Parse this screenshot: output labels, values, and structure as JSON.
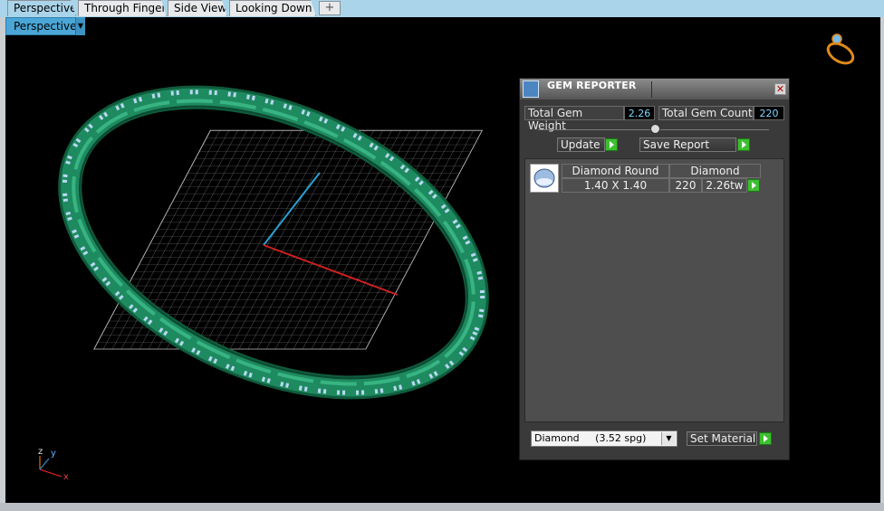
{
  "tabs": [
    {
      "label": "Perspective",
      "active": true
    },
    {
      "label": "Through Finger",
      "active": false
    },
    {
      "label": "Side View",
      "active": false
    },
    {
      "label": "Looking Down",
      "active": false
    }
  ],
  "add_tab_icon": "plus-icon",
  "viewport": {
    "view_label": "Perspective",
    "axis": {
      "x": "x",
      "y": "y",
      "z": "z"
    }
  },
  "gem_reporter": {
    "title": "GEM REPORTER",
    "total_gem_weight_label": "Total Gem Weight",
    "total_gem_weight_value": "2.26",
    "total_gem_count_label": "Total Gem Count",
    "total_gem_count_value": "220",
    "update_label": "Update",
    "save_report_label": "Save Report",
    "gem_row": {
      "cut": "Diamond Round",
      "material": "Diamond",
      "size": "1.40 X 1.40",
      "count": "220",
      "weight": "2.26tw"
    },
    "material_select": "Diamond     (3.52 spg)",
    "set_material_label": "Set Material"
  },
  "colors": {
    "ring_green": "#1e8a5f",
    "gem_blue": "#b8d8f4",
    "tab_active": "#aad4ea",
    "go_green": "#3cbf2e"
  }
}
